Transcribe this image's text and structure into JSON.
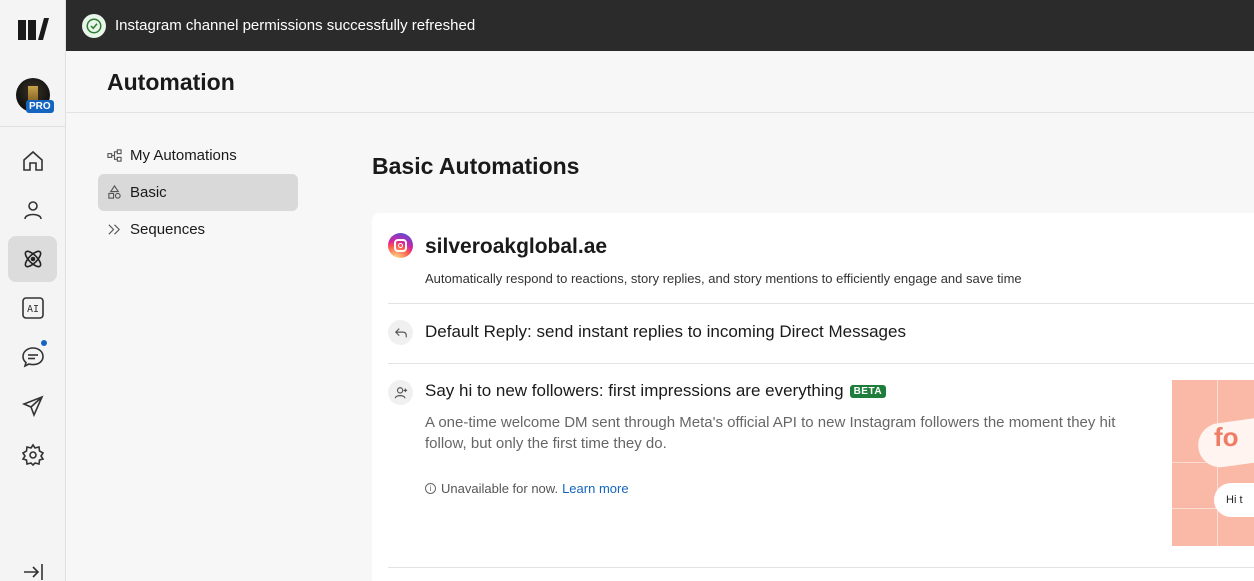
{
  "toast": {
    "message": "Instagram channel permissions successfully refreshed"
  },
  "rail": {
    "badge": "PRO",
    "items": [
      {
        "name": "home-icon"
      },
      {
        "name": "contacts-icon"
      },
      {
        "name": "automation-icon",
        "active": true
      },
      {
        "name": "ai-icon",
        "label": "AI"
      },
      {
        "name": "chat-icon",
        "notification": true
      },
      {
        "name": "send-icon"
      },
      {
        "name": "settings-icon"
      },
      {
        "name": "collapse-icon"
      }
    ]
  },
  "header": {
    "title": "Automation"
  },
  "subnav": {
    "items": [
      {
        "label": "My Automations",
        "icon": "flow-icon"
      },
      {
        "label": "Basic",
        "icon": "shapes-icon",
        "active": true
      },
      {
        "label": "Sequences",
        "icon": "sequence-icon"
      }
    ]
  },
  "main": {
    "title": "Basic Automations",
    "account": {
      "name": "silveroakglobal.ae",
      "description": "Automatically respond to reactions, story replies, and story mentions to efficiently engage and save time"
    },
    "rows": [
      {
        "title": "Default Reply: send instant replies to incoming Direct Messages",
        "icon": "reply-icon"
      },
      {
        "title": "Say hi to new followers: first impressions are everything",
        "badge": "BETA",
        "icon": "user-icon",
        "description": "A one-time welcome DM sent through Meta's official API to new Instagram followers the moment they hit follow, but only the first time they do.",
        "unavailable": "Unavailable for now.",
        "learn_more": "Learn more",
        "preview_bubble": "fo",
        "preview_chat": "Hi t"
      }
    ]
  },
  "colors": {
    "accent": "#1565c0",
    "beta": "#1e7d3b",
    "toast_bg": "#2b2b2b",
    "preview_bg": "#f9b9a6"
  }
}
